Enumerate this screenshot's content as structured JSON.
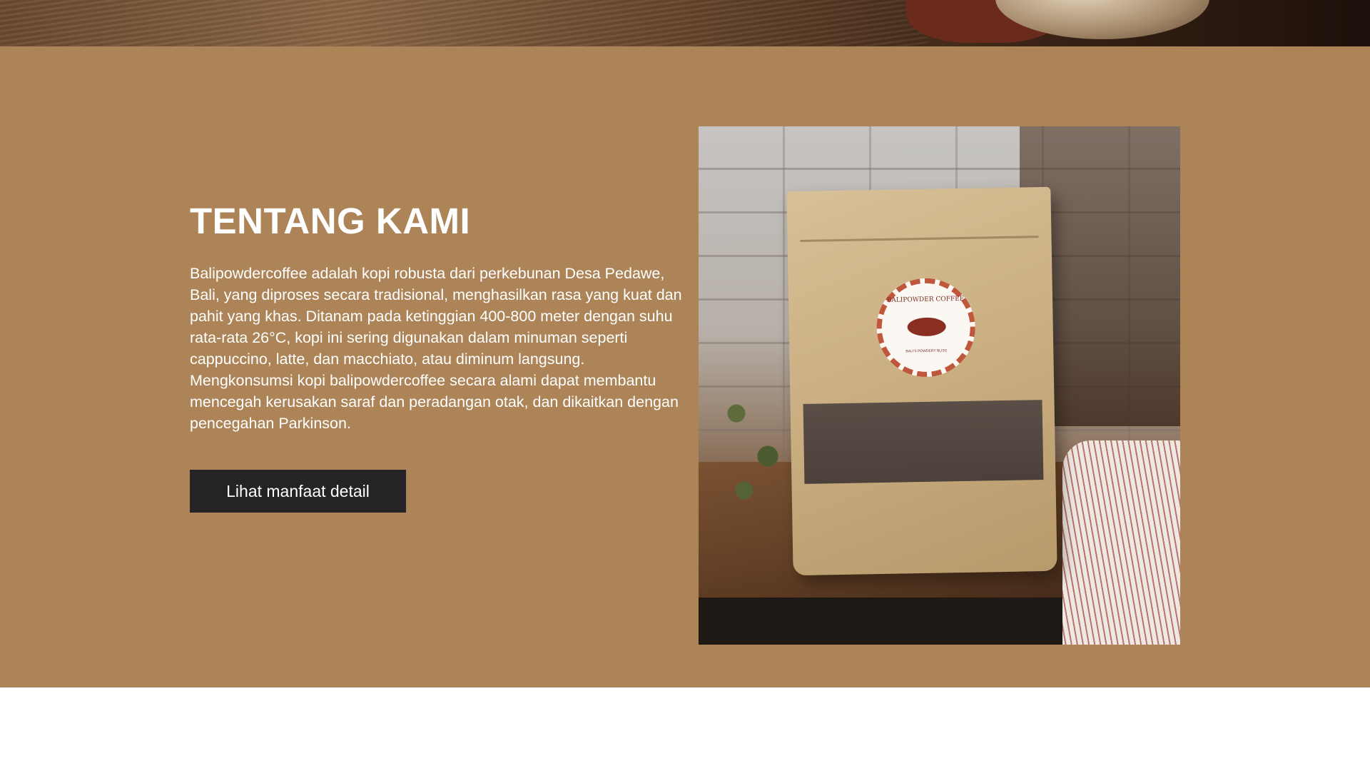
{
  "about": {
    "title": "TENTANG KAMI",
    "description": "Balipowdercoffee adalah kopi robusta dari perkebunan Desa Pedawe, Bali, yang diproses secara tradisional, menghasilkan rasa yang kuat dan pahit yang khas. Ditanam pada ketinggian 400-800 meter dengan suhu rata-rata 26°C, kopi ini sering digunakan dalam minuman seperti cappuccino, latte, dan macchiato, atau diminum langsung. Mengkonsumsi kopi balipowdercoffee secara alami dapat membantu mencegah kerusakan saraf dan peradangan otak, dan dikaitkan dengan pencegahan Parkinson.",
    "button_label": "Lihat manfaat detail"
  },
  "product_label": {
    "brand": "BALIPOWDER COFFEE",
    "tagline": "BALI'S POWDERY BLISS"
  },
  "colors": {
    "section_bg": "#ad8458",
    "button_bg": "#242426",
    "text": "#ffffff"
  }
}
